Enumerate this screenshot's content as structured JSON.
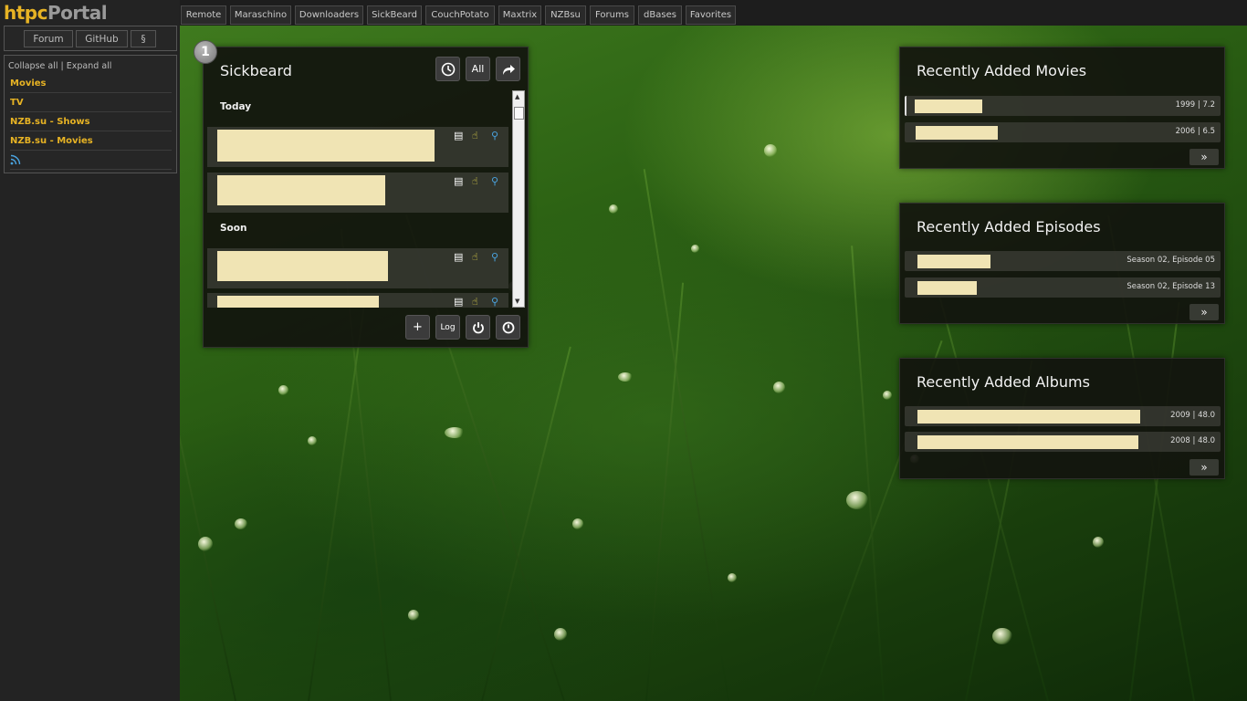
{
  "app": {
    "logo_part1": "htpc",
    "logo_part2": "Portal"
  },
  "sidebar": {
    "links": [
      "Forum",
      "GitHub",
      "§"
    ],
    "collapse_all": "Collapse all",
    "separator": "|",
    "expand_all": "Expand all",
    "menu_items": [
      "Movies",
      "TV",
      "NZB.su - Shows",
      "NZB.su - Movies"
    ]
  },
  "topnav": {
    "items": [
      "Remote",
      "Maraschino",
      "Downloaders",
      "SickBeard",
      "CouchPotato",
      "Maxtrix",
      "NZBsu",
      "Forums",
      "dBases",
      "Favorites"
    ]
  },
  "sickbeard": {
    "badge": "1",
    "title": "Sickbeard",
    "all_label": "All",
    "sections": [
      "Today",
      "Soon"
    ],
    "add_label": "+",
    "log_label": "Log"
  },
  "movies": {
    "title": "Recently Added Movies",
    "rows": [
      {
        "meta": "1999 | 7.2"
      },
      {
        "meta": "2006 | 6.5"
      }
    ],
    "more": "»"
  },
  "episodes": {
    "title": "Recently Added Episodes",
    "rows": [
      {
        "meta": "Season 02, Episode 05"
      },
      {
        "meta": "Season 02, Episode 13"
      }
    ],
    "more": "»"
  },
  "albums": {
    "title": "Recently Added Albums",
    "rows": [
      {
        "meta": "2009 | 48.0"
      },
      {
        "meta": "2008 | 48.0"
      }
    ],
    "more": "»"
  },
  "colors": {
    "accent": "#e7b324",
    "bar_fill": "#f0e4b4",
    "panel_bg": "#12140e"
  }
}
